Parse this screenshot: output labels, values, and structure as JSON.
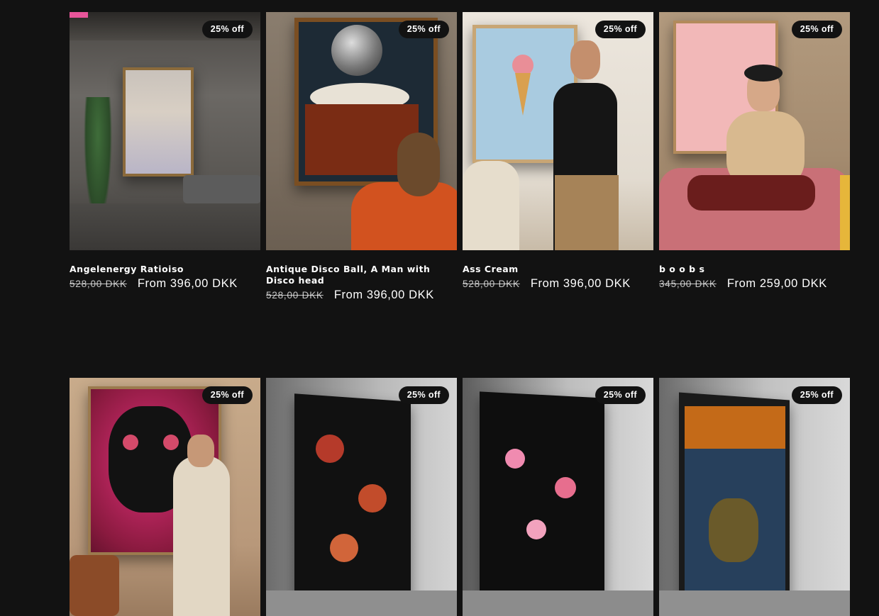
{
  "products": [
    {
      "title": "Angelenergy Ratioiso",
      "badge": "25% off",
      "price_old": "528,00 DKK",
      "price_new": "From 396,00 DKK"
    },
    {
      "title": "Antique Disco Ball, A Man with Disco head",
      "badge": "25% off",
      "price_old": "528,00 DKK",
      "price_new": "From 396,00 DKK"
    },
    {
      "title": "Ass Cream",
      "badge": "25% off",
      "price_old": "528,00 DKK",
      "price_new": "From 396,00 DKK"
    },
    {
      "title": "b o o b s",
      "badge": "25% off",
      "price_old": "345,00 DKK",
      "price_new": "From 259,00 DKK"
    },
    {
      "badge": "25% off"
    },
    {
      "badge": "25% off"
    },
    {
      "badge": "25% off"
    },
    {
      "badge": "25% off"
    }
  ],
  "colors": {
    "background": "#121212",
    "text": "#ffffff",
    "badge_bg": "#121212"
  }
}
